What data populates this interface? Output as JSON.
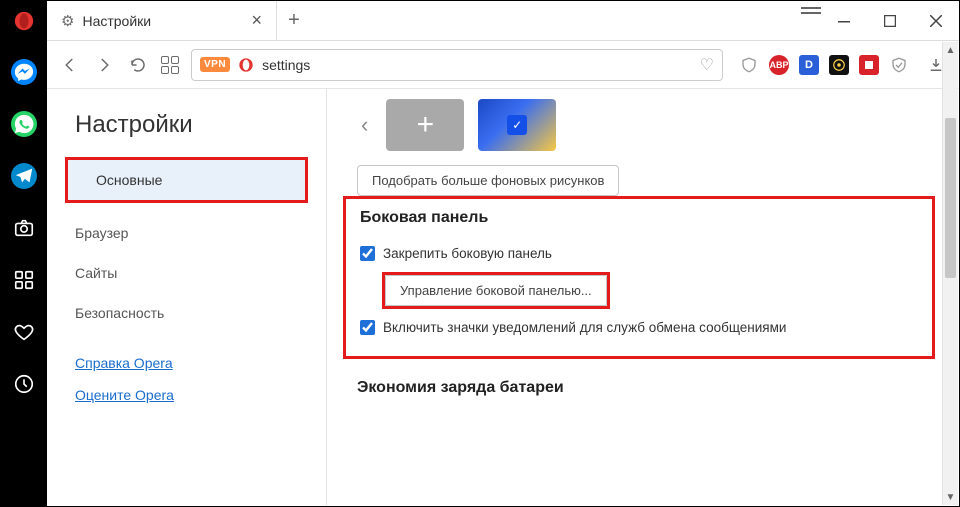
{
  "titlebar": {
    "tab_title": "Настройки"
  },
  "addressbar": {
    "vpn_label": "VPN",
    "url": "settings"
  },
  "settings_nav": {
    "heading": "Настройки",
    "items": {
      "basic": "Основные",
      "browser": "Браузер",
      "sites": "Сайты",
      "security": "Безопасность",
      "help": "Справка Opera",
      "rate": "Оцените Opera"
    }
  },
  "settings_pane": {
    "more_wallpapers_btn": "Подобрать больше фоновых рисунков",
    "sidepanel_heading": "Боковая панель",
    "pin_sidepanel_label": "Закрепить боковую панель",
    "manage_sidepanel_btn": "Управление боковой панелью...",
    "notif_icons_label": "Включить значки уведомлений для служб обмена сообщениями",
    "battery_heading": "Экономия заряда батареи"
  }
}
